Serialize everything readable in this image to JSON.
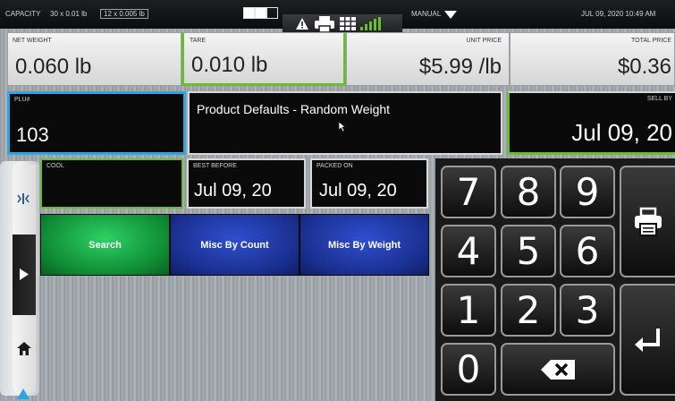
{
  "status": {
    "capacity_label": "CAPACITY",
    "capacity_1": "30 x 0.01 lb",
    "capacity_2": "12 x 0.005 lb",
    "mode": "MANUAL",
    "datetime": "JUL 09, 2020 10:49 AM"
  },
  "fields": {
    "net_weight": {
      "label": "NET WEIGHT",
      "value": "0.060 lb"
    },
    "tare": {
      "label": "TARE",
      "value": "0.010 lb"
    },
    "unit_price": {
      "label": "UNIT PRICE",
      "value": "$5.99 /lb"
    },
    "total_price": {
      "label": "TOTAL PRICE",
      "value": "$0.36"
    },
    "plu": {
      "label": "PLU#",
      "value": "103"
    },
    "description": "Product Defaults - Random Weight",
    "sell_by": {
      "label": "SELL BY",
      "value": "Jul 09, 20"
    },
    "cool": {
      "label": "COOL",
      "value": ""
    },
    "best_before": {
      "label": "BEST BEFORE",
      "value": "Jul 09, 20"
    },
    "packed_on": {
      "label": "PACKED ON",
      "value": "Jul 09, 20"
    }
  },
  "buttons": {
    "search": "Search",
    "misc_count": "Misc By Count",
    "misc_weight": "Misc By Weight"
  },
  "keypad": {
    "k7": "7",
    "k8": "8",
    "k9": "9",
    "k4": "4",
    "k5": "5",
    "k6": "6",
    "k1": "1",
    "k2": "2",
    "k3": "3",
    "k0": "0"
  },
  "icons": [
    "warning-icon",
    "printer-icon",
    "grid-icon",
    "signal-icon",
    "chevron-down-icon",
    "backspace-icon",
    "enter-icon",
    "home-icon",
    "play-icon",
    "scale-icon",
    "cursor-icon"
  ],
  "colors": {
    "accent_green": "#6bbd2f",
    "accent_blue": "#2aa6e0",
    "search_green": "#1fae4a",
    "misc_blue": "#1e3a9e"
  }
}
